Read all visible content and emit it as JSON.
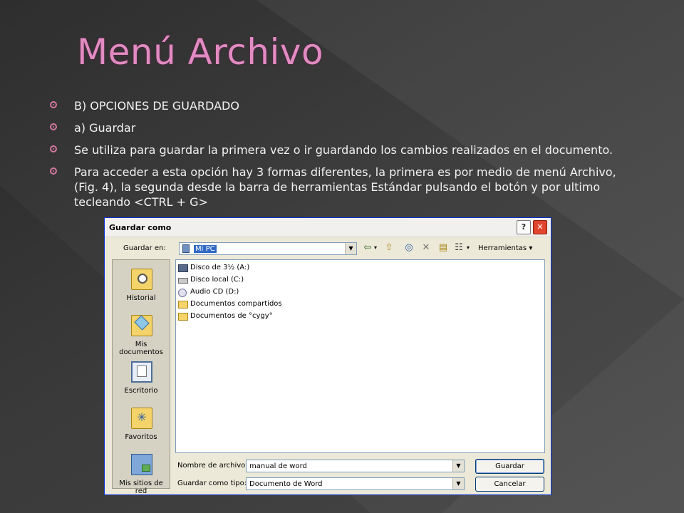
{
  "slide": {
    "title": "Menú Archivo",
    "bullets": [
      "B) OPCIONES DE GUARDADO",
      "a) Guardar",
      "Se utiliza para guardar la primera vez o ir guardando los cambios realizados en el documento.",
      "Para acceder a esta opción hay 3 formas diferentes, la primera es por medio de menú Archivo, (Fig. 4), la segunda desde la barra de herramientas Estándar pulsando el botón y por ultimo tecleando <CTRL + G>"
    ],
    "title_color": "#e28bc2",
    "bullet_color": "#d6779f"
  },
  "dialog": {
    "title": "Guardar como",
    "help_button": "?",
    "close_button": "✕",
    "save_in_label": "Guardar en:",
    "save_in_value": "Mi PC",
    "tools_label": "Herramientas",
    "places": [
      {
        "label": "Historial",
        "icon": "history-icon"
      },
      {
        "label": "Mis documentos",
        "icon": "my-documents-icon"
      },
      {
        "label": "Escritorio",
        "icon": "desktop-icon"
      },
      {
        "label": "Favoritos",
        "icon": "favorites-icon"
      },
      {
        "label": "Mis sitios de red",
        "icon": "network-places-icon"
      }
    ],
    "files": [
      {
        "name": "Disco de 3½ (A:)",
        "icon": "floppy-drive-icon"
      },
      {
        "name": "Disco local (C:)",
        "icon": "hard-drive-icon"
      },
      {
        "name": "Audio CD (D:)",
        "icon": "cd-drive-icon"
      },
      {
        "name": "Documentos compartidos",
        "icon": "folder-icon"
      },
      {
        "name": "Documentos de °cygy°",
        "icon": "folder-icon"
      }
    ],
    "file_name_label": "Nombre de archivo:",
    "file_name_value": "manual de word",
    "file_type_label": "Guardar como tipo:",
    "file_type_value": "Documento de Word",
    "save_button": "Guardar",
    "cancel_button": "Cancelar"
  }
}
